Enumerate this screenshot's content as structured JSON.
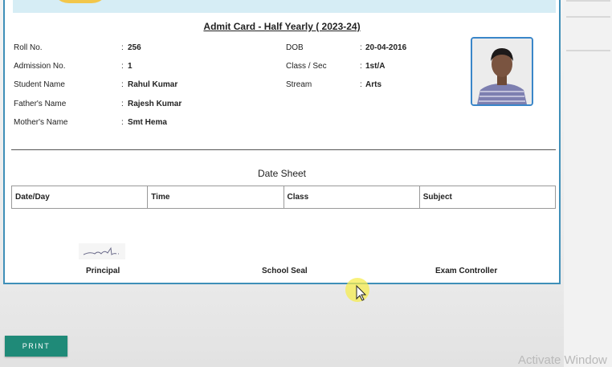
{
  "card": {
    "title": "Admit Card - Half Yearly ( 2023-24)",
    "left_fields": [
      {
        "label": "Roll No.",
        "value": "256"
      },
      {
        "label": "Admission No.",
        "value": "1"
      },
      {
        "label": "Student Name",
        "value": "Rahul Kumar"
      },
      {
        "label": "Father's Name",
        "value": "Rajesh Kumar"
      },
      {
        "label": "Mother's Name",
        "value": "Smt Hema"
      }
    ],
    "right_fields": [
      {
        "label": "DOB",
        "value": "20-04-2016"
      },
      {
        "label": "Class / Sec",
        "value": "1st/A"
      },
      {
        "label": "Stream",
        "value": "Arts"
      }
    ],
    "separator": ":"
  },
  "date_sheet": {
    "title": "Date Sheet",
    "columns": [
      "Date/Day",
      "Time",
      "Class",
      "Subject"
    ]
  },
  "signatures": {
    "principal": "Principal",
    "seal": "School Seal",
    "controller": "Exam Controller"
  },
  "print_button": "PRINT",
  "watermark": "Activate Window",
  "colors": {
    "card_border": "#3f8fb8",
    "print_button": "#1f8a78",
    "banner": "#d6edf5"
  }
}
